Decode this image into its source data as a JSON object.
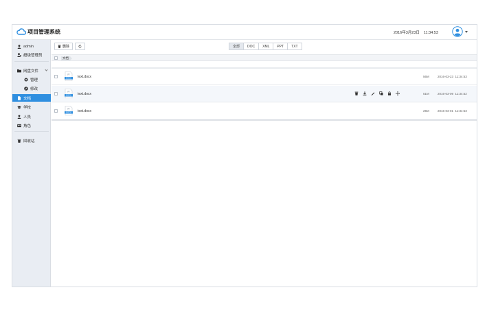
{
  "header": {
    "app_title": "项目管理系统",
    "date": "2016年3月23日",
    "time": "11:34:53"
  },
  "sidebar": {
    "users": [
      {
        "label": "admin",
        "icon": "user-icon"
      },
      {
        "label": "超级管理员",
        "icon": "user-shield-icon"
      }
    ],
    "items": [
      {
        "label": "网盘文件",
        "icon": "folder-icon"
      },
      {
        "label": "管理",
        "icon": "gear-icon"
      },
      {
        "label": "修改",
        "icon": "edit-circle-icon"
      },
      {
        "label": "文档",
        "icon": "document-icon"
      },
      {
        "label": "学校",
        "icon": "graduation-cap-icon"
      },
      {
        "label": "人员",
        "icon": "person-icon"
      },
      {
        "label": "角色",
        "icon": "id-card-icon"
      },
      {
        "label": "回收站",
        "icon": "trash-icon"
      }
    ],
    "active_color": "#2f8fe0"
  },
  "toolbar": {
    "delete_label": "删除",
    "refresh_icon": "refresh-icon"
  },
  "filter_tabs": [
    "全部",
    "DOC",
    "XML",
    "PPT",
    "TXT"
  ],
  "breadcrumb": {
    "current": "文档"
  },
  "files": [
    {
      "name": "text.docx",
      "size": "56M",
      "date": "2016-03-23",
      "time": "11:34:53",
      "type_badge": "DOCX"
    },
    {
      "name": "text.docx",
      "size": "51M",
      "date": "2016-03-09",
      "time": "11:34:52",
      "type_badge": "DOCX"
    },
    {
      "name": "text.docx",
      "size": "25M",
      "date": "2016-03-01",
      "time": "11:34:53",
      "type_badge": "DOCX"
    }
  ],
  "row_action_icons": [
    "trash-icon",
    "download-icon",
    "pencil-icon",
    "copy-icon",
    "lock-icon",
    "move-icon"
  ]
}
